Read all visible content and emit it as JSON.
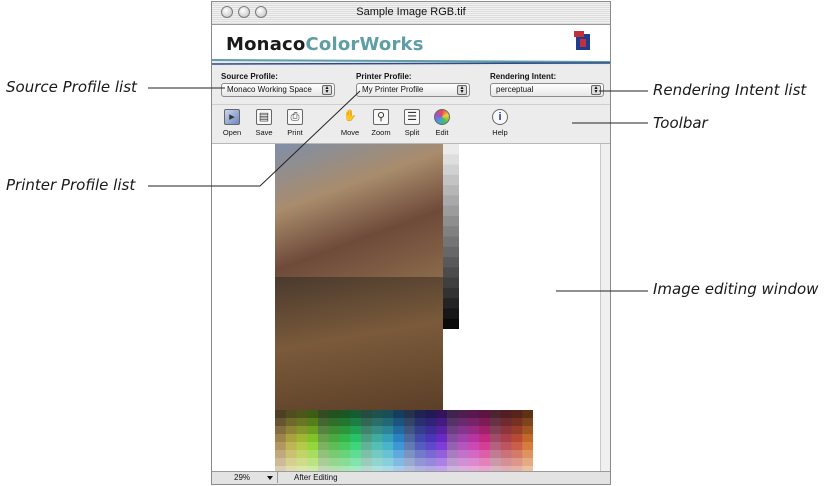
{
  "window": {
    "title": "Sample Image RGB.tif"
  },
  "brand": {
    "name_part1": "Monaco",
    "name_part2": "ColorWorks"
  },
  "profiles": {
    "source": {
      "label": "Source Profile:",
      "value": "Monaco Working Space"
    },
    "printer": {
      "label": "Printer Profile:",
      "value": "My Printer Profile"
    },
    "intent": {
      "label": "Rendering Intent:",
      "value": "perceptual"
    }
  },
  "toolbar": {
    "open": "Open",
    "save": "Save",
    "print": "Print",
    "move": "Move",
    "zoom": "Zoom",
    "split": "Split",
    "edit": "Edit",
    "help": "Help"
  },
  "status": {
    "zoom": "29%",
    "state": "After Editing"
  },
  "callouts": {
    "source_profile": "Source Profile list",
    "printer_profile": "Printer Profile list",
    "rendering_intent": "Rendering Intent list",
    "toolbar": "Toolbar",
    "image_window": "Image editing window"
  },
  "icons": {
    "open": "open-icon",
    "save": "floppy-disk-icon",
    "print": "printer-icon",
    "move": "hand-icon",
    "zoom": "magnifier-icon",
    "split": "split-icon",
    "edit": "color-wheel-icon",
    "help": "info-icon"
  }
}
